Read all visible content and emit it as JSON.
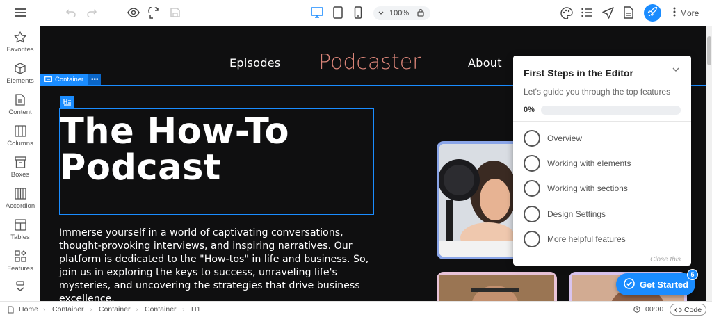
{
  "toolbar": {
    "zoom": "100%",
    "more_label": "More"
  },
  "sidebar": {
    "items": [
      {
        "label": "Favorites",
        "icon": "star-icon"
      },
      {
        "label": "Elements",
        "icon": "cube-icon"
      },
      {
        "label": "Content",
        "icon": "document-icon"
      },
      {
        "label": "Columns",
        "icon": "columns-icon"
      },
      {
        "label": "Boxes",
        "icon": "box-icon"
      },
      {
        "label": "Accordion",
        "icon": "accordion-icon"
      },
      {
        "label": "Tables",
        "icon": "table-icon"
      },
      {
        "label": "Features",
        "icon": "features-icon"
      }
    ]
  },
  "site": {
    "nav_episodes": "Episodes",
    "logo": "Podcaster",
    "nav_about": "About",
    "container_label": "Container",
    "container_dots": "•••",
    "heading": "The How-To Podcast",
    "paragraph": "Immerse yourself in a world of captivating conversations, thought-provoking interviews, and inspiring narratives. Our platform is dedicated to the \"How-tos\" in life and business. So, join us in exploring the keys to success, unraveling life's mysteries, and uncovering the strategies that drive business excellence."
  },
  "panel": {
    "title": "First Steps in the Editor",
    "subtitle": "Let's guide you through the top features",
    "progress_label": "0%",
    "progress": 0,
    "steps": [
      "Overview",
      "Working with elements",
      "Working with sections",
      "Design Settings",
      "More helpful features"
    ],
    "close_label": "Close this"
  },
  "get_started": {
    "label": "Get Started",
    "badge": "5"
  },
  "breadcrumb": [
    "Home",
    "Container",
    "Container",
    "Container",
    "H1"
  ],
  "status": {
    "timer": "00:00",
    "code_label": "Code"
  },
  "colors": {
    "accent": "#1a8cff",
    "canvas_bg": "#0f0f10",
    "logo": "#d98478"
  }
}
